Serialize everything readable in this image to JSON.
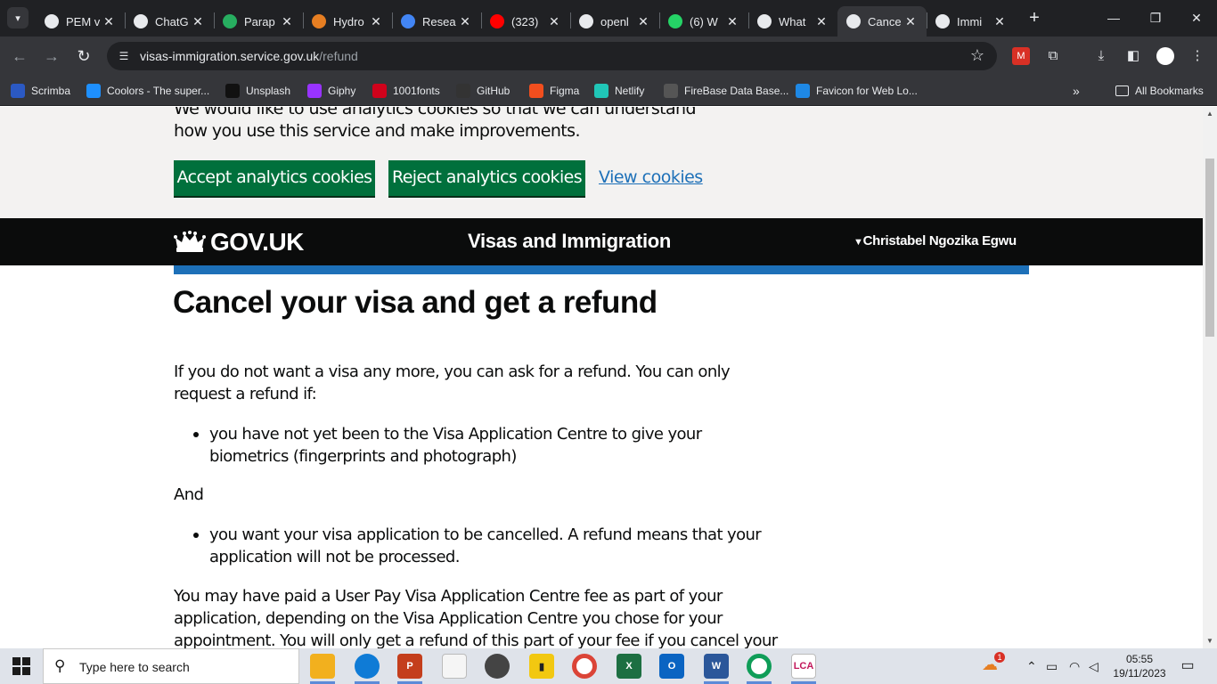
{
  "browser": {
    "tabs": [
      {
        "label": "PEM v",
        "icon": "github-icon",
        "color": "#e8eaed"
      },
      {
        "label": "ChatG",
        "icon": "chatgpt-icon",
        "color": "#e8eaed"
      },
      {
        "label": "Parap",
        "icon": "paraphrase-icon",
        "color": "#27ae60"
      },
      {
        "label": "Hydro",
        "icon": "hydro-icon",
        "color": "#e67e22"
      },
      {
        "label": "Resea",
        "icon": "bookmark-icon",
        "color": "#4285f4"
      },
      {
        "label": "(323)",
        "icon": "youtube-icon",
        "color": "#ff0000"
      },
      {
        "label": "openl",
        "icon": "wordpress-icon",
        "color": "#e8eaed"
      },
      {
        "label": "(6) W",
        "icon": "whatsapp-icon",
        "color": "#25d366"
      },
      {
        "label": "What",
        "icon": "crown-icon",
        "color": "#e8eaed"
      },
      {
        "label": "Cance",
        "icon": "crown-icon",
        "color": "#e8eaed",
        "active": true
      },
      {
        "label": "Immi",
        "icon": "crown-icon",
        "color": "#e8eaed"
      }
    ],
    "url_host": "visas-immigration.service.gov.uk",
    "url_path": "/refund",
    "bookmarks": [
      {
        "label": "Scrimba",
        "icon": "scrimba-icon",
        "color": "#2b59c3"
      },
      {
        "label": "Coolors - The super...",
        "icon": "coolors-icon",
        "color": "#1e90ff"
      },
      {
        "label": "Unsplash",
        "icon": "unsplash-icon",
        "color": "#111111"
      },
      {
        "label": "Giphy",
        "icon": "giphy-icon",
        "color": "#9933ff"
      },
      {
        "label": "1001fonts",
        "icon": "fonts-icon",
        "color": "#d0021b"
      },
      {
        "label": "GitHub",
        "icon": "github-icon",
        "color": "#333333"
      },
      {
        "label": "Figma",
        "icon": "figma-icon",
        "color": "#f24e1e"
      },
      {
        "label": "Netlify",
        "icon": "netlify-icon",
        "color": "#20c6b7"
      },
      {
        "label": "FireBase Data Base...",
        "icon": "globe-icon",
        "color": "#555555"
      },
      {
        "label": "Favicon for Web Lo...",
        "icon": "favicon-icon",
        "color": "#1e88e5"
      }
    ],
    "all_bookmarks": "All Bookmarks"
  },
  "cookies": {
    "text": "We would like to use analytics cookies so that we can understand how you use this service and make improvements.",
    "accept": "Accept analytics cookies",
    "reject": "Reject analytics cookies",
    "view": "View cookies",
    "btn_color": "#00703c"
  },
  "header": {
    "logo": "GOV.UK",
    "service": "Visas and Immigration",
    "user": "Christabel Ngozika Egwu",
    "bar_color": "#1d70b8"
  },
  "content": {
    "title": "Cancel your visa and get a refund",
    "p1": "If you do not want a visa any more, you can ask for a refund. You can only request a refund if:",
    "bullet1": "you have not yet been to the Visa Application Centre to give your biometrics (fingerprints and photograph)",
    "and": "And",
    "bullet2": "you want your visa application to be cancelled. A refund means that your application will not be processed.",
    "p2": "You may have paid a User Pay Visa Application Centre fee as part of your application, depending on the Visa Application Centre you chose for your appointment. You will only get a refund of this part of your fee if you cancel your application and claim a"
  },
  "taskbar": {
    "search": "Type here to search",
    "time": "05:55",
    "date": "19/11/2023",
    "weather_badge": "1"
  }
}
